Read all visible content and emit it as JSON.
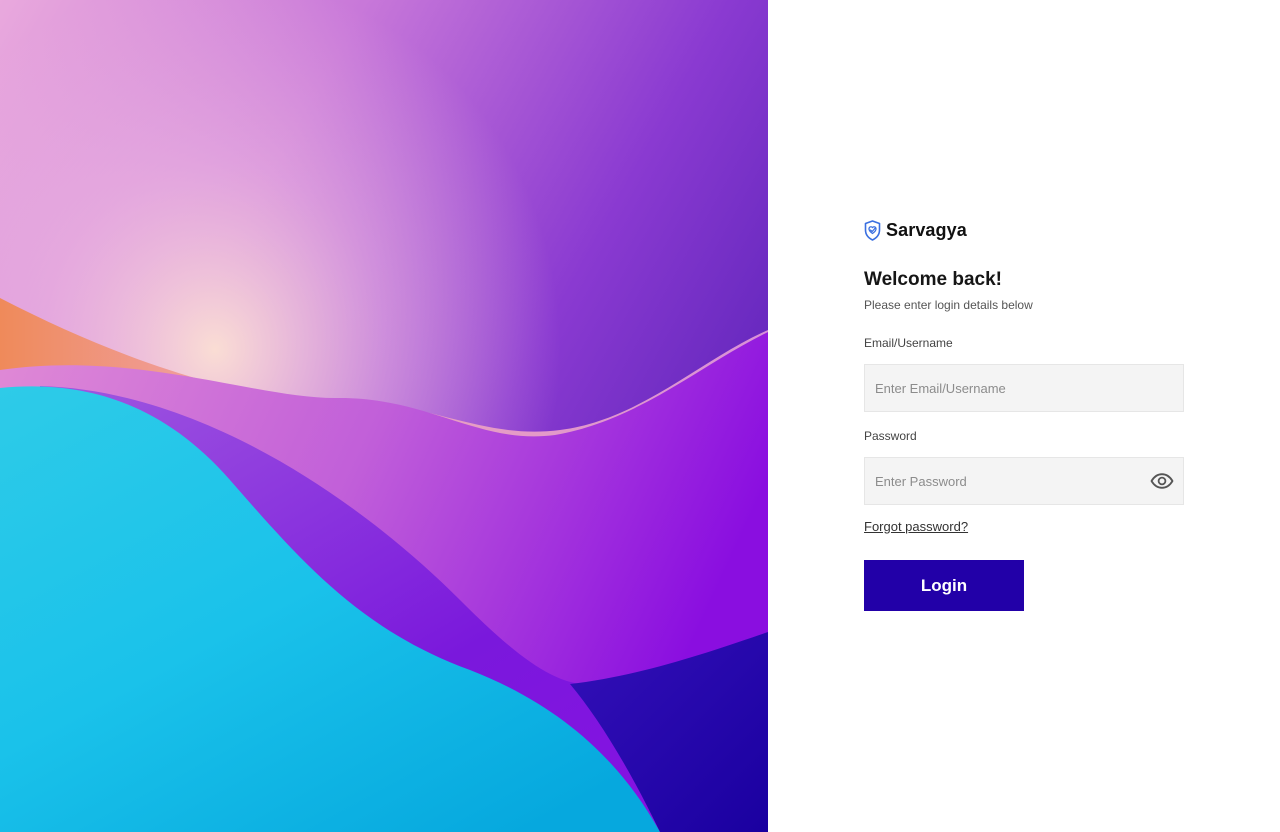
{
  "brand": {
    "name": "Sarvagya",
    "icon": "shield-icon"
  },
  "login": {
    "heading": "Welcome back!",
    "subheading": "Please enter login details below",
    "email": {
      "label": "Email/Username",
      "placeholder": "Enter Email/Username",
      "value": ""
    },
    "password": {
      "label": "Password",
      "placeholder": "Enter Password",
      "value": "",
      "toggle_icon": "eye-icon"
    },
    "forgot_label": "Forgot password?",
    "submit_label": "Login"
  },
  "colors": {
    "accent": "#2200a8",
    "brand_icon": "#3a6fe0",
    "input_bg": "#f4f4f4",
    "text_dark": "#161616"
  }
}
